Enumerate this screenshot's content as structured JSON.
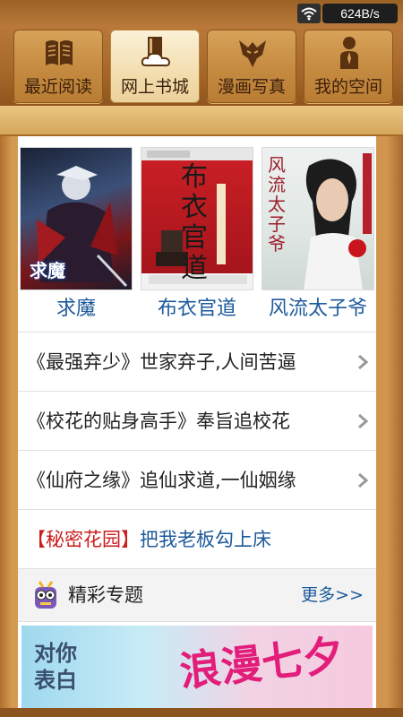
{
  "status_bar": {
    "network_speed": "624B/s"
  },
  "tabs": [
    {
      "label": "最近阅读",
      "icon": "open-book-icon",
      "active": false
    },
    {
      "label": "网上书城",
      "icon": "cloud-book-icon",
      "active": true
    },
    {
      "label": "漫画写真",
      "icon": "transformer-emblem-icon",
      "active": false
    },
    {
      "label": "我的空间",
      "icon": "person-icon",
      "active": false
    }
  ],
  "featured_books": [
    {
      "title": "求魔",
      "cover_text": "求魔"
    },
    {
      "title": "布衣官道",
      "cover_text": "布衣官道"
    },
    {
      "title": "风流太子爷",
      "cover_text": "风流太子爷"
    }
  ],
  "recommendations": [
    {
      "text": "《最强弃少》世家弃子,人间苦逼"
    },
    {
      "text": "《校花的贴身高手》奉旨追校花"
    },
    {
      "text": "《仙府之缘》追仙求道,一仙姻缘"
    }
  ],
  "promo": {
    "tag": "【秘密花园】",
    "link": "把我老板勾上床"
  },
  "section": {
    "title": "精彩专题",
    "more": "更多>>"
  },
  "banner": {
    "left_text": "对你表白",
    "right_text": "浪漫七夕"
  },
  "colors": {
    "link": "#1d5a9b",
    "tag": "#cc1c1c",
    "wood": "#c98f45"
  }
}
